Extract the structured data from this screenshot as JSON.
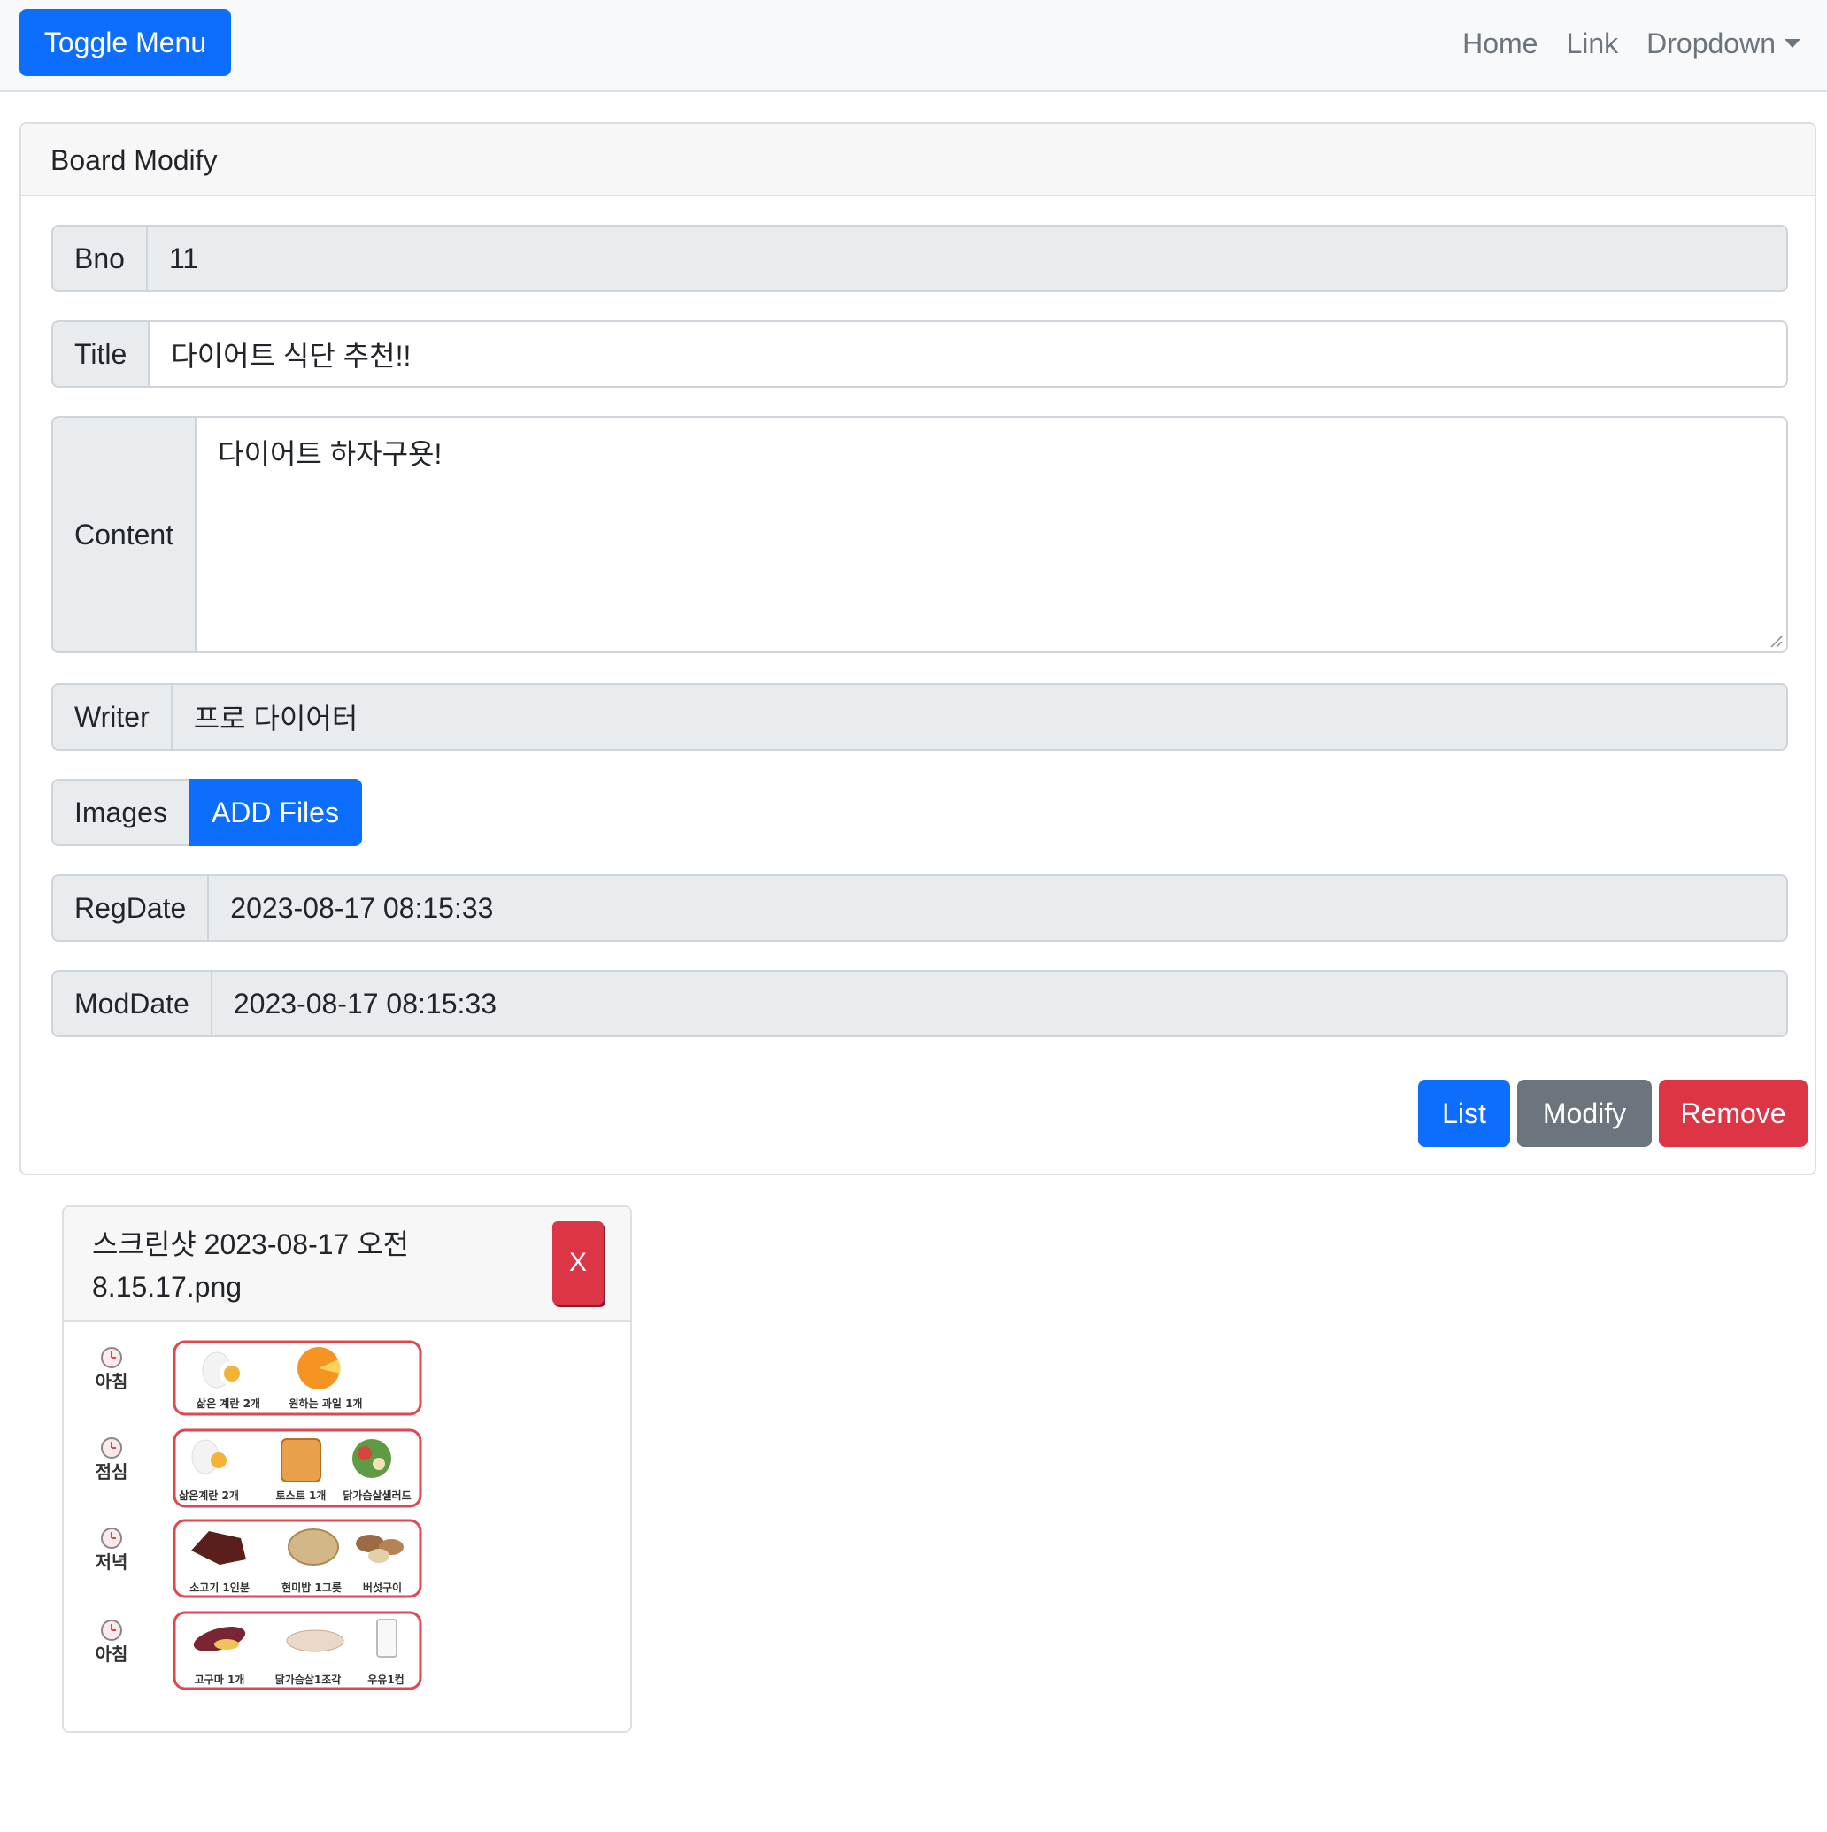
{
  "navbar": {
    "toggle_label": "Toggle Menu",
    "links": [
      {
        "label": "Home"
      },
      {
        "label": "Link"
      },
      {
        "label": "Dropdown"
      }
    ]
  },
  "card": {
    "header": "Board Modify",
    "fields": {
      "bno": {
        "label": "Bno",
        "value": "11"
      },
      "title": {
        "label": "Title",
        "value": "다이어트 식단 추천!!"
      },
      "content": {
        "label": "Content",
        "value": "다이어트 하자구욧!"
      },
      "writer": {
        "label": "Writer",
        "value": "프로 다이어터"
      },
      "images": {
        "label": "Images",
        "button": "ADD Files"
      },
      "regdate": {
        "label": "RegDate",
        "value": "2023-08-17 08:15:33"
      },
      "moddate": {
        "label": "ModDate",
        "value": "2023-08-17 08:15:33"
      }
    },
    "buttons": {
      "list": "List",
      "modify": "Modify",
      "remove": "Remove"
    }
  },
  "attachment": {
    "filename": "스크린샷 2023-08-17 오전 8.15.17.png",
    "remove_label": "X",
    "meals": [
      {
        "time": "아침",
        "items": [
          "삶은 계란 2개",
          "원하는 과일 1개"
        ]
      },
      {
        "time": "점심",
        "items": [
          "삶은계란 2개",
          "토스트 1개",
          "닭가슴살샐러드"
        ]
      },
      {
        "time": "저녁",
        "items": [
          "소고기 1인분",
          "현미밥 1그릇",
          "버섯구이"
        ]
      },
      {
        "time": "아침",
        "items": [
          "고구마 1개",
          "닭가슴살1조각",
          "우유1컵"
        ]
      }
    ]
  },
  "colors": {
    "primary": "#0d6efd",
    "secondary": "#6c757d",
    "danger": "#dc3545",
    "meal_border": "#e0474f"
  }
}
